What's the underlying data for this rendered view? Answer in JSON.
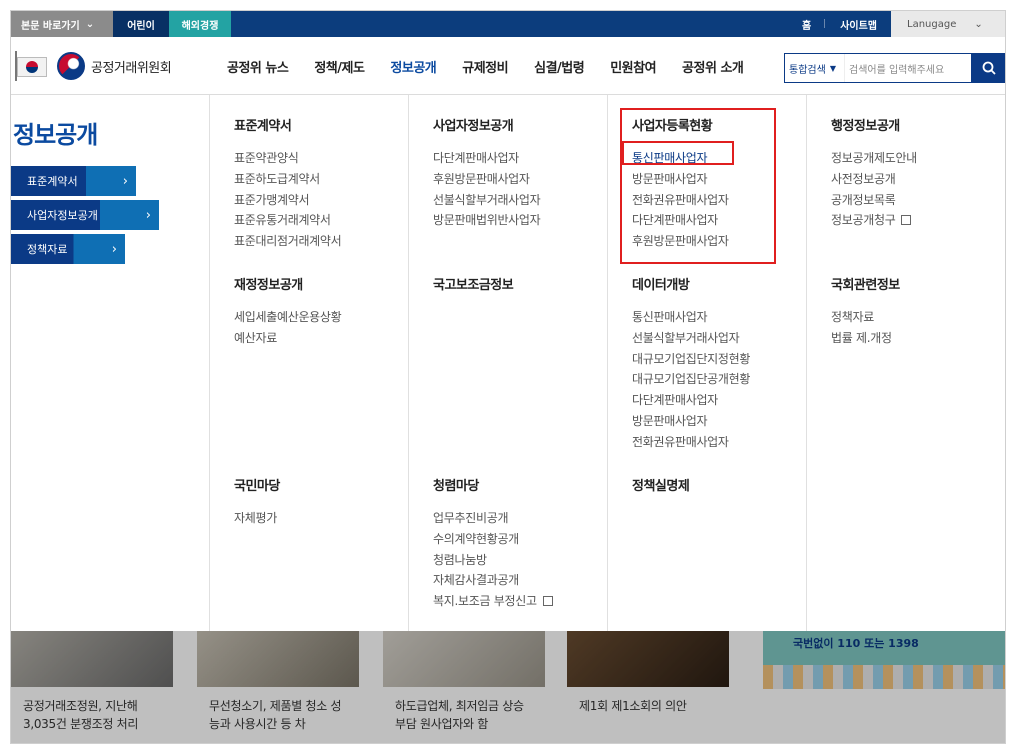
{
  "topbar": {
    "skip_label": "본문 바로가기",
    "kids_label": "어린이",
    "competition_label": "해외경쟁",
    "home_label": "홈",
    "sitemap_label": "사이트맵",
    "language_label": "Lanugage"
  },
  "header": {
    "logo_text": "공정거래위원회",
    "nav": [
      "공정위 뉴스",
      "정책/제도",
      "정보공개",
      "규제정비",
      "심결/법령",
      "민원참여",
      "공정위 소개"
    ],
    "active_nav_index": 2,
    "search": {
      "scope": "통합검색",
      "placeholder": "검색어를 입력해주세요"
    }
  },
  "side": {
    "title": "정보공개",
    "buttons": [
      "표준계약서",
      "사업자정보공개",
      "정책자료"
    ]
  },
  "menu": {
    "col1": {
      "groups": [
        {
          "title": "표준계약서",
          "items": [
            "표준약관양식",
            "표준하도급계약서",
            "표준가맹계약서",
            "표준유통거래계약서",
            "표준대리점거래계약서"
          ]
        },
        {
          "title": "재정정보공개",
          "items": [
            "세입세출예산운용상황",
            "예산자료"
          ]
        },
        {
          "title": "국민마당",
          "items": [
            "자체평가"
          ]
        }
      ]
    },
    "col2": {
      "groups": [
        {
          "title": "사업자정보공개",
          "items": [
            "다단계판매사업자",
            "후원방문판매사업자",
            "선불식할부거래사업자",
            "방문판매법위반사업자"
          ]
        },
        {
          "title": "국고보조금정보",
          "items": []
        },
        {
          "title": "청렴마당",
          "items": [
            "업무추진비공개",
            "수의계약현황공개",
            "청렴나눔방",
            "자체감사결과공개",
            "복지.보조금 부정신고"
          ]
        }
      ]
    },
    "col3": {
      "groups": [
        {
          "title": "사업자등록현황",
          "items": [
            "통신판매사업자",
            "방문판매사업자",
            "전화권유판매사업자",
            "다단계판매사업자",
            "후원방문판매사업자"
          ]
        },
        {
          "title": "데이터개방",
          "items": [
            "통신판매사업자",
            "선불식할부거래사업자",
            "대규모기업집단지정현황",
            "대규모기업집단공개현황",
            "다단계판매사업자",
            "방문판매사업자",
            "전화권유판매사업자"
          ]
        },
        {
          "title": "정책실명제",
          "items": []
        }
      ]
    },
    "col4": {
      "groups": [
        {
          "title": "행정정보공개",
          "items": [
            "정보공개제도안내",
            "사전정보공개",
            "공개정보목록",
            "정보공개청구"
          ]
        },
        {
          "title": "국회관련정보",
          "items": [
            "정책자료",
            "법률 제.개정"
          ]
        }
      ]
    }
  },
  "background_cards": [
    "공정거래조정원, 지난해 3,035건 분쟁조정 처리",
    "무선청소기, 제품별 청소 성능과 사용시간 등 차",
    "하도급업체, 최저임금 상승 부담 원사업자와 함",
    "제1회 제1소회의 의안"
  ],
  "banner_phone": "국번없이 110 또는 1398",
  "colors": {
    "primary": "#0b3a86",
    "teal": "#23a3a3",
    "highlight_box": "#e01f1f"
  }
}
